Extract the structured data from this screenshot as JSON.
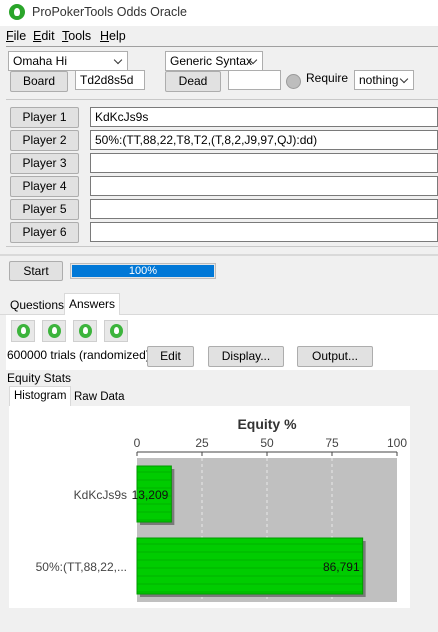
{
  "window": {
    "title": "ProPokerTools Odds Oracle"
  },
  "menu": [
    {
      "label": "File",
      "mnemonic": "F",
      "rest": "ile"
    },
    {
      "label": "Edit",
      "mnemonic": "E",
      "rest": "dit"
    },
    {
      "label": "Tools",
      "mnemonic": "T",
      "rest": "ools"
    },
    {
      "label": "Help",
      "mnemonic": "H",
      "rest": "elp"
    }
  ],
  "controls": {
    "game_select": "Omaha Hi",
    "syntax_select": "Generic Syntax",
    "board_button": "Board",
    "board_value": "Td2d8s5d",
    "dead_button": "Dead",
    "dead_value": "",
    "require_label": "Require",
    "require_select": "nothing"
  },
  "players": [
    {
      "button": "Player 1",
      "value": "KdKcJs9s"
    },
    {
      "button": "Player 2",
      "value": "50%:(TT,88,22,T8,T2,(T,8,2,J9,97,QJ):dd)"
    },
    {
      "button": "Player 3",
      "value": ""
    },
    {
      "button": "Player 4",
      "value": ""
    },
    {
      "button": "Player 5",
      "value": ""
    },
    {
      "button": "Player 6",
      "value": ""
    }
  ],
  "run": {
    "start_button": "Start",
    "progress_label": "100%",
    "progress_fraction": 1.0
  },
  "main_tabs": [
    {
      "label": "Questions"
    },
    {
      "label": "Answers"
    }
  ],
  "answers": {
    "trials_text": "600000 trials (randomized)",
    "edit_button": "Edit",
    "display_button": "Display...",
    "output_button": "Output...",
    "section_label": "Equity Stats",
    "sub_tabs": [
      {
        "label": "Histogram"
      },
      {
        "label": "Raw Data"
      }
    ],
    "toolbar_icons": [
      "oracle-drop-icon",
      "oracle-drop-icon",
      "oracle-drop-icon",
      "oracle-drop-icon"
    ]
  },
  "colors": {
    "bar_fill": "#00cc00",
    "bar_dark": "#009a00",
    "plot_bg": "#c0c0c0",
    "progress": "#0078d7",
    "brand": "#2aa52a"
  },
  "chart_data": {
    "type": "bar",
    "orientation": "horizontal",
    "title": "Equity %",
    "categories": [
      "KdKcJs9s",
      "50%:(TT,88,22,..."
    ],
    "values": [
      13.209,
      86.791
    ],
    "value_labels": [
      "13,209",
      "86,791"
    ],
    "xlim": [
      0,
      100
    ],
    "xticks": [
      0,
      25,
      50,
      75,
      100
    ],
    "grid": true
  }
}
